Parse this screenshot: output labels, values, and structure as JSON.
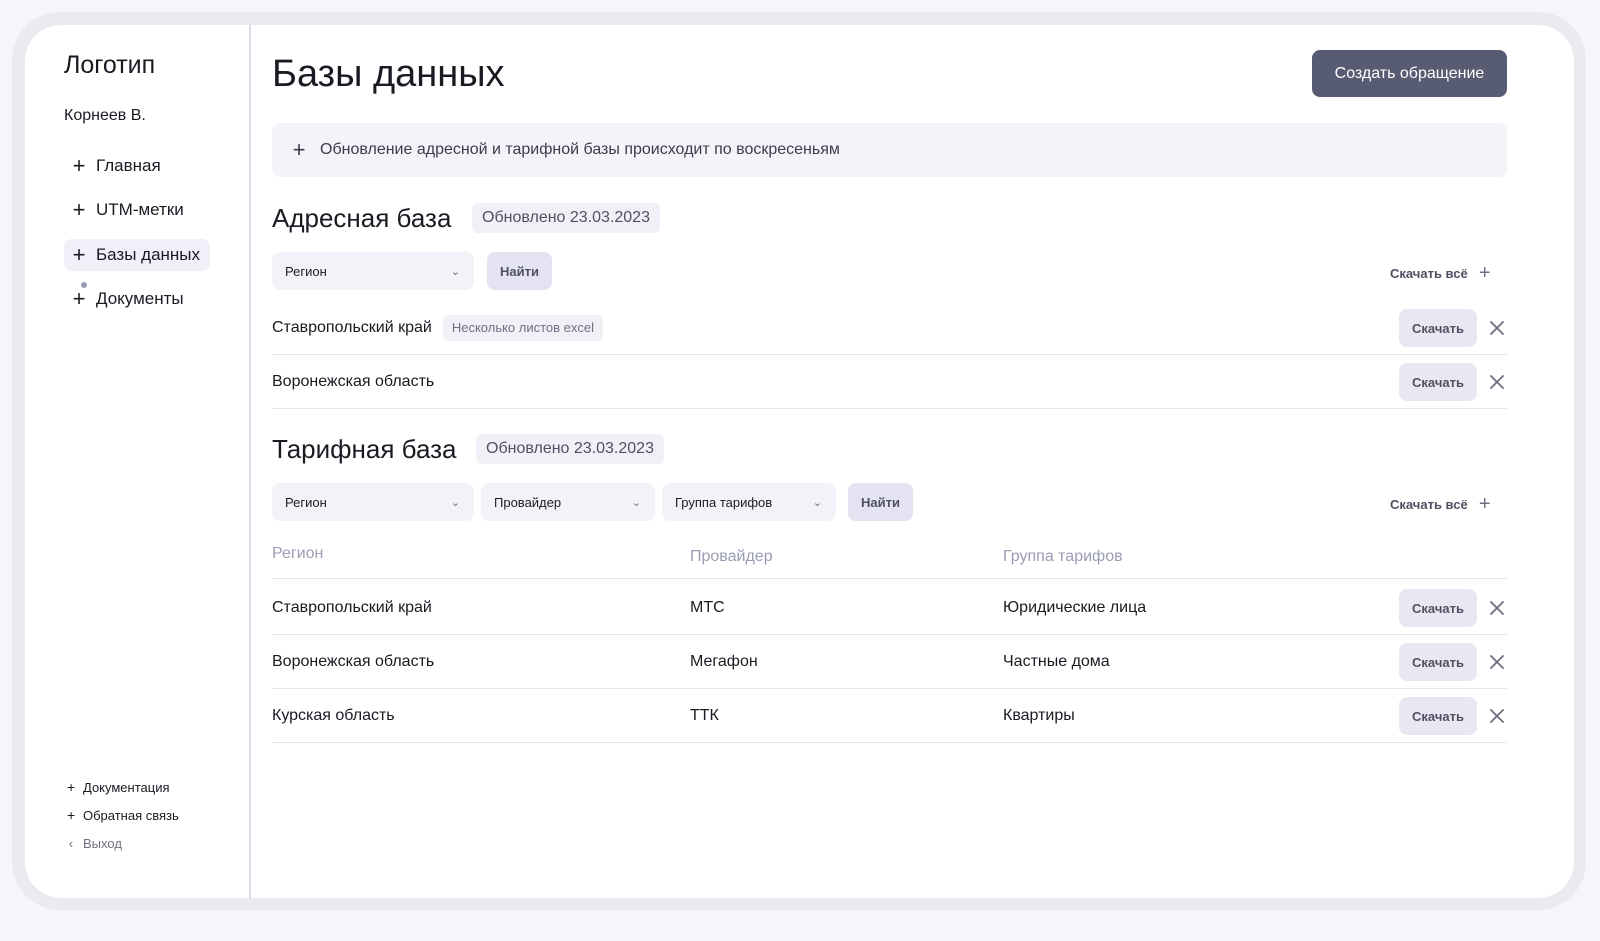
{
  "sidebar": {
    "logo": "Логотип",
    "user": "Корнеев В.",
    "nav": [
      {
        "label": "Главная",
        "icon": "plus-icon",
        "active": false
      },
      {
        "label": "UTM-метки",
        "icon": "plus-icon",
        "active": false
      },
      {
        "label": "Базы данных",
        "icon": "plus-icon",
        "active": true
      },
      {
        "label": "Документы",
        "icon": "plus-icon",
        "active": false
      }
    ],
    "footer": [
      {
        "label": "Документация",
        "icon": "plus-icon"
      },
      {
        "label": "Обратная связь",
        "icon": "plus-icon"
      },
      {
        "label": "Выход",
        "icon": "chevron-left-icon"
      }
    ]
  },
  "header": {
    "title": "Базы данных",
    "create_button": "Создать обращение"
  },
  "notice": {
    "text": "Обновление адресной и тарифной базы происходит по воскресеньям"
  },
  "address_base": {
    "title": "Адресная база",
    "updated": "Обновлено 23.03.2023",
    "filters": {
      "region": "Регион"
    },
    "find_label": "Найти",
    "download_all": "Скачать всё",
    "rows": [
      {
        "region": "Ставропольский край",
        "tag": "Несколько листов excel",
        "download": "Скачать"
      },
      {
        "region": "Воронежская область",
        "tag": "",
        "download": "Скачать"
      }
    ]
  },
  "tariff_base": {
    "title": "Тарифная база",
    "updated": "Обновлено 23.03.2023",
    "filters": {
      "region": "Регион",
      "provider": "Провайдер",
      "tariff_group": "Группа тарифов"
    },
    "find_label": "Найти",
    "download_all": "Скачать всё",
    "columns": [
      "Регион",
      "Провайдер",
      "Группа тарифов"
    ],
    "rows": [
      {
        "region": "Ставропольский край",
        "provider": "МТС",
        "tariff_group": "Юридические лица",
        "download": "Скачать"
      },
      {
        "region": "Воронежская область",
        "provider": "Мегафон",
        "tariff_group": "Частные дома",
        "download": "Скачать"
      },
      {
        "region": "Курская область",
        "provider": "ТТК",
        "tariff_group": "Квартиры",
        "download": "Скачать"
      }
    ]
  },
  "colors": {
    "accent_button": "#585c72",
    "muted_header": "#9a9db3",
    "surface": "#f3f2f8"
  }
}
